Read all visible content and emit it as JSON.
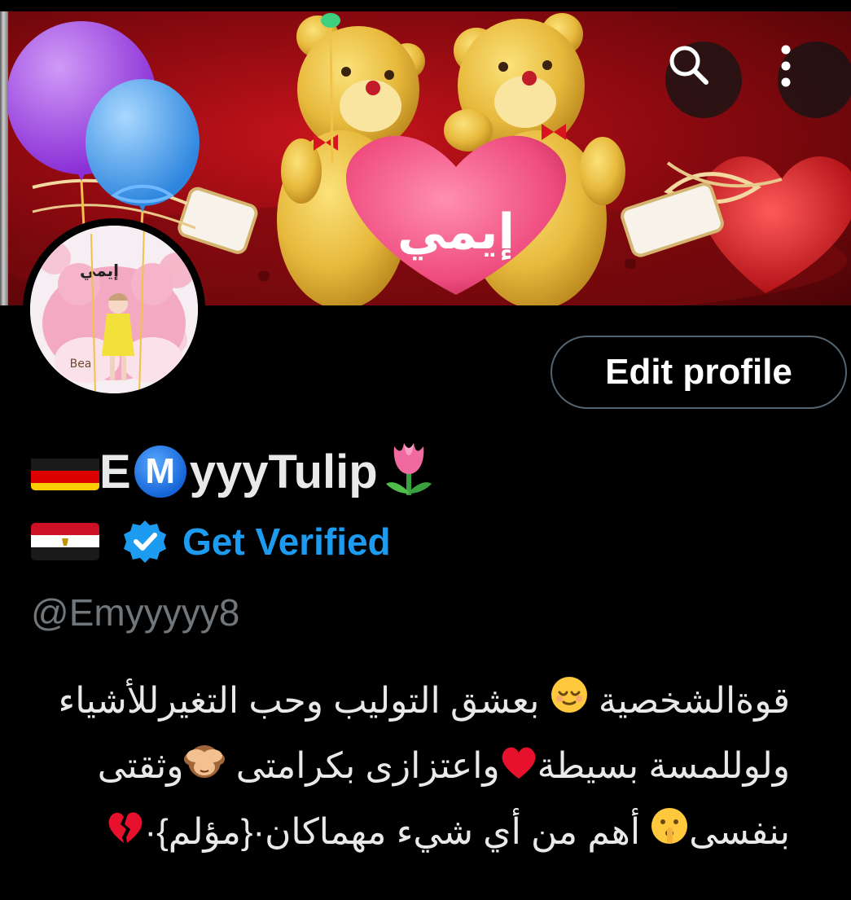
{
  "banner": {
    "heart_text": "إيمي",
    "avatar_text": "إيمي",
    "avatar_bear_text": "Bea"
  },
  "header_actions": {
    "search_icon": "search-icon",
    "more_icon": "more-vertical-icon"
  },
  "profile": {
    "edit_label": "Edit profile",
    "name_prefix": "E",
    "name_badge": "M",
    "name_suffix": "yyyTulip",
    "get_verified_label": "Get Verified",
    "handle": "@Emyyyyy8",
    "bio": {
      "line1": "قوةالشخصية",
      "line1b": "بعشق التوليب وحب التغيرللأشياء",
      "line2a": "ولوللمسة بسيطة",
      "line2b": "واعتزازى بكرامتى",
      "line2c": "وثقتى",
      "line3a": "بنفسى",
      "line3b": "أهم من أي شيء مهماكان·{مؤلم}·"
    }
  },
  "colors": {
    "background": "#000000",
    "text_primary": "#e7e9ea",
    "text_secondary": "#71767b",
    "accent_blue": "#1d9bf0",
    "button_border": "#536471"
  }
}
